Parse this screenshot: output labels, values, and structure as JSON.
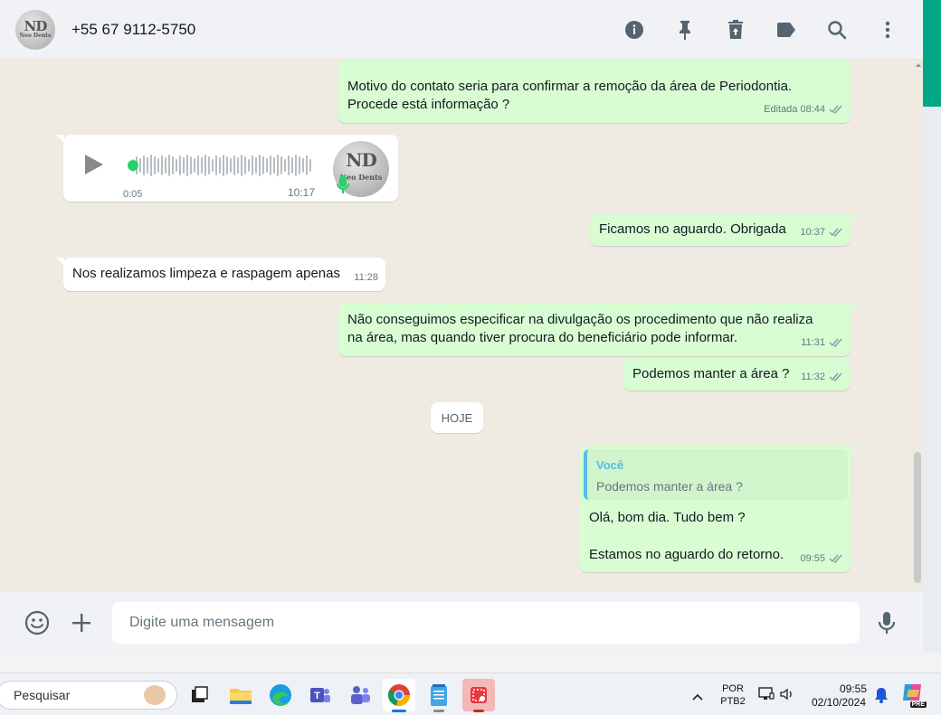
{
  "header": {
    "avatar_mono": "ND",
    "avatar_brand": "Neo Dents",
    "contact": "+55 67 9112-5750",
    "icons": [
      "info-icon",
      "pin-icon",
      "delete-icon",
      "label-icon",
      "search-icon",
      "menu-icon"
    ]
  },
  "messages": [
    {
      "text": "Motivo do contato seria para confirmar a remoção da área de Periodontia. Procede está informação ?",
      "meta": "Editada 08:44",
      "dir": "out"
    },
    {
      "type": "audio",
      "elapsed": "0:05",
      "time": "10:17",
      "dir": "in"
    },
    {
      "text": "Ficamos no aguardo. Obrigada",
      "meta": "10:37",
      "dir": "out"
    },
    {
      "text": "Nos realizamos limpeza e raspagem apenas",
      "meta": "11:28",
      "dir": "in"
    },
    {
      "text": "Não conseguimos especificar na divulgação os procedimento que não realiza na área, mas quando tiver procura do beneficiário pode informar.",
      "meta": "11:31",
      "dir": "out"
    },
    {
      "text": "Podemos manter a área ?",
      "meta": "11:32",
      "dir": "out"
    },
    {
      "type": "reply",
      "quote_author": "Você",
      "quote_text": "Podemos manter a área ?",
      "line1": "Olá, bom dia. Tudo bem ?",
      "line2": "Estamos no aguardo do retorno.",
      "meta": "09:55",
      "dir": "out"
    }
  ],
  "day_divider": "HOJE",
  "composer": {
    "placeholder": "Digite uma mensagem"
  },
  "taskbar": {
    "search_label": "Pesquisar",
    "lang_line1": "POR",
    "lang_line2": "PTB2",
    "time": "09:55",
    "date": "02/10/2024",
    "copilot_badge": "PRE"
  },
  "colors": {
    "outgoing": "#d9fdd3",
    "incoming": "#ffffff",
    "accent": "#00a884",
    "read_ticks": "#8696a0",
    "quote_bar": "#53bdeb"
  }
}
